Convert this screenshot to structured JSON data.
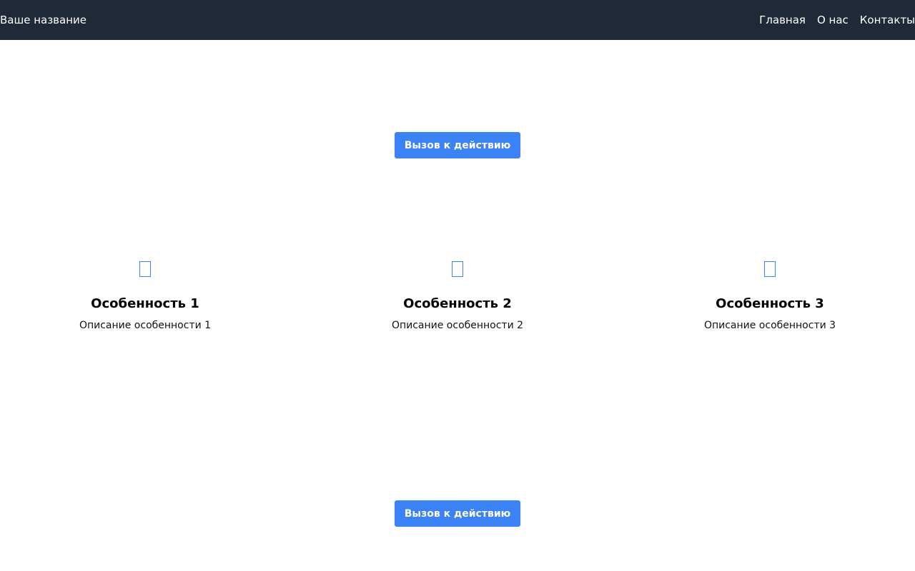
{
  "header": {
    "brand": "Ваше название",
    "nav": [
      {
        "label": "Главная"
      },
      {
        "label": "О нас"
      },
      {
        "label": "Контакты"
      }
    ]
  },
  "hero": {
    "cta_label": "Вызов к действию"
  },
  "features": [
    {
      "title": "Особенность 1",
      "description": "Описание особенности 1",
      "icon": "placeholder-icon"
    },
    {
      "title": "Особенность 2",
      "description": "Описание особенности 2",
      "icon": "placeholder-icon"
    },
    {
      "title": "Особенность 3",
      "description": "Описание особенности 3",
      "icon": "placeholder-icon"
    }
  ],
  "footer_cta": {
    "cta_label": "Вызов к действию"
  },
  "colors": {
    "navbar_bg": "#1f2937",
    "accent": "#3b82f6"
  }
}
